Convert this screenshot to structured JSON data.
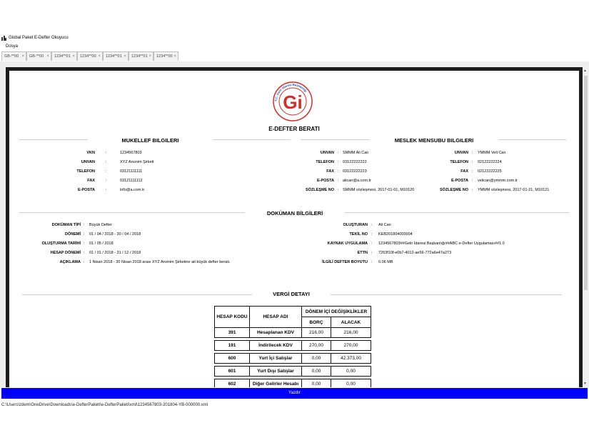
{
  "window": {
    "title": "Global Paket E-Defter Okuyucu"
  },
  "menu": {
    "items": [
      "Dosya"
    ]
  },
  "tabs": [
    {
      "label": "GB-**00"
    },
    {
      "label": "GB-**00"
    },
    {
      "label": "1234**01"
    },
    {
      "label": "1234**00"
    },
    {
      "label": "1234**01"
    },
    {
      "label": "1234**01"
    },
    {
      "label": "1234**00"
    }
  ],
  "logo": {
    "text": "T.C. Gelir İdaresi Başkanlığı",
    "glyph": "Gi"
  },
  "document": {
    "title": "E-DEFTER BERATI",
    "mukellef": {
      "heading": "MUKELLEF BILGILERI",
      "rows": [
        {
          "label": "VKN",
          "value": "1234567803"
        },
        {
          "label": "UNVAN",
          "value": "XYZ Anonim Şirketi"
        },
        {
          "label": "TELEFON",
          "value": "03121111111"
        },
        {
          "label": "FAX",
          "value": "03121111112"
        },
        {
          "label": "E-POSTA",
          "value": "info@a.com.tr"
        }
      ]
    },
    "meslek": {
      "heading": "MESLEK MENSUBU BILGILERI",
      "col1": [
        {
          "label": "UNVAN",
          "value": "SMMM Ali Can"
        },
        {
          "label": "TELEFON",
          "value": "03122222222"
        },
        {
          "label": "FAX",
          "value": "03122222223"
        },
        {
          "label": "E-POSTA",
          "value": "alican@a.com.tr"
        },
        {
          "label": "SÖZLEŞME NO",
          "value": "SMMM sözleşmesi, 2017-01-01, M10120"
        }
      ],
      "col2": [
        {
          "label": "UNVAN",
          "value": "YMMM Veli Can"
        },
        {
          "label": "TELEFON",
          "value": "02122222224"
        },
        {
          "label": "FAX",
          "value": "02122222225"
        },
        {
          "label": "E-POSTA",
          "value": "velican@ymmm.com.tr"
        },
        {
          "label": "SÖZLEŞME NO",
          "value": "YMMM sözleşmesi, 2017-01-21, M10121"
        }
      ]
    },
    "dokuman": {
      "heading": "DOKÜMAN BİLGİLERİ",
      "left": [
        {
          "label": "DOKÜMAN TİPİ",
          "value": "Büyük Defter"
        },
        {
          "label": "DÖNEMİ",
          "value": "01 / 04 / 2018  -  30 / 04 / 2018"
        },
        {
          "label": "OLUŞTURMA TARİHİ",
          "value": "01 / 05 / 2018"
        },
        {
          "label": "HESAP DÖNEMİ",
          "value": "01 / 01 / 2018  -  31 / 12 / 2018"
        },
        {
          "label": "AÇIKLAMA",
          "value": "1 Nisan 2018 - 30 Nisan 2018 arası XYZ Anonim Şirketine ait büyük defter beratı."
        }
      ],
      "right": [
        {
          "label": "OLUŞTURAN",
          "value": "Ali Can"
        },
        {
          "label": "TEKİL NO",
          "value": "KEB201804000004"
        },
        {
          "label": "KAYNAK UYGULAMA",
          "value": "1234567803##Gelir İdaresi Başkanlığı##ABC e-Defter Uygulaması##1.0"
        },
        {
          "label": "ETTN",
          "value": "7253f10f-e0b7-4012-ae56-772a6e47a273"
        },
        {
          "label": "İLGİLİ DEFTER BOYUTU",
          "value": "0.06 MB"
        }
      ]
    },
    "vergi": {
      "heading": "VERGİ DETAYI",
      "headers": {
        "hesap_kodu": "HESAP KODU",
        "hesap_adi": "HESAP ADI",
        "donem": "DÖNEM İÇİ DEĞİŞİKLİKLER",
        "borc": "BORÇ",
        "alacak": "ALACAK"
      },
      "rows": [
        {
          "code": "391",
          "name": "Hesaplanan KDV",
          "borc": "216,00",
          "alacak": "216,00"
        },
        {
          "code": "191",
          "name": "İndirilecek KDV",
          "borc": "270,00",
          "alacak": "270,00"
        },
        {
          "code": "600",
          "name": "Yurt İçi Satışlar",
          "borc": "0,00",
          "alacak": "42.373,00"
        },
        {
          "code": "601",
          "name": "Yurt Dışı Satışlar",
          "borc": "0,00",
          "alacak": "0,00"
        },
        {
          "code": "602",
          "name": "Diğer Gelirler Hesabı",
          "borc": "0,00",
          "alacak": "0,00"
        }
      ]
    }
  },
  "footer": {
    "view_button": "Yazdır",
    "status_path": "C:\\Users\\zdem\\OneDrive\\Downloads\\e-DefterPaketi\\e-DefterPaketi\\xml\\1234567803-201804-YB-000000.xml"
  }
}
